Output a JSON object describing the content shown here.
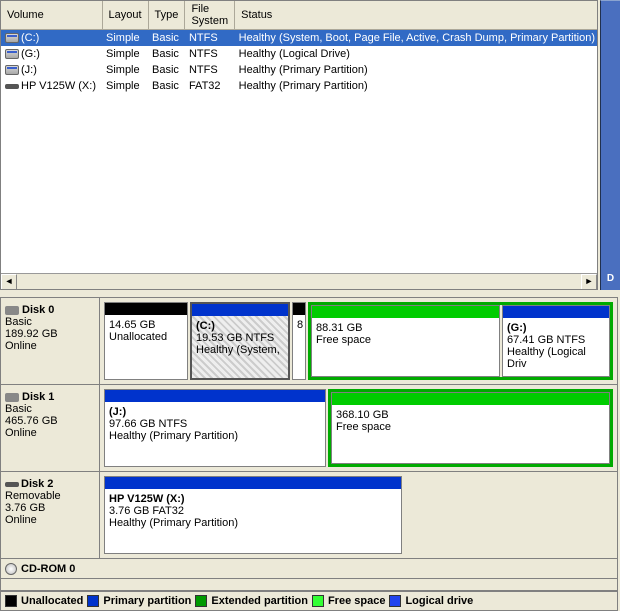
{
  "volumes": {
    "headers": [
      "Volume",
      "Layout",
      "Type",
      "File System",
      "Status"
    ],
    "rows": [
      {
        "name": "(C:)",
        "layout": "Simple",
        "vtype": "Basic",
        "fs": "NTFS",
        "status": "Healthy (System, Boot, Page File, Active, Crash Dump, Primary Partition)"
      },
      {
        "name": "(G:)",
        "layout": "Simple",
        "vtype": "Basic",
        "fs": "NTFS",
        "status": "Healthy (Logical Drive)"
      },
      {
        "name": "(J:)",
        "layout": "Simple",
        "vtype": "Basic",
        "fs": "NTFS",
        "status": "Healthy (Primary Partition)"
      },
      {
        "name": "HP V125W (X:)",
        "layout": "Simple",
        "vtype": "Basic",
        "fs": "FAT32",
        "status": "Healthy (Primary Partition)"
      }
    ]
  },
  "disks": {
    "d0": {
      "title": "Disk 0",
      "line1": "Basic",
      "line2": "189.92 GB",
      "line3": "Online",
      "p0": {
        "name": "",
        "size": "14.65 GB",
        "status": "Unallocated"
      },
      "p1": {
        "name": "(C:)",
        "size": "19.53 GB NTFS",
        "status": "Healthy (System,"
      },
      "p2": {
        "name": "",
        "size": "8",
        "status": ""
      },
      "p3": {
        "name": "",
        "size": "88.31 GB",
        "status": "Free space"
      },
      "p4": {
        "name": "(G:)",
        "size": "67.41 GB NTFS",
        "status": "Healthy (Logical Driv"
      }
    },
    "d1": {
      "title": "Disk 1",
      "line1": "Basic",
      "line2": "465.76 GB",
      "line3": "Online",
      "p0": {
        "name": "(J:)",
        "size": "97.66 GB NTFS",
        "status": "Healthy (Primary Partition)"
      },
      "p1": {
        "name": "",
        "size": "368.10 GB",
        "status": "Free space"
      }
    },
    "d2": {
      "title": "Disk 2",
      "line1": "Removable",
      "line2": "3.76 GB",
      "line3": "Online",
      "p0": {
        "name": "HP V125W  (X:)",
        "size": "3.76 GB FAT32",
        "status": "Healthy (Primary Partition)"
      }
    },
    "cd": {
      "title": "CD-ROM 0"
    }
  },
  "legend": {
    "unalloc": "Unallocated",
    "primary": "Primary partition",
    "extended": "Extended partition",
    "free": "Free space",
    "logical": "Logical drive"
  },
  "right_strip": "D"
}
